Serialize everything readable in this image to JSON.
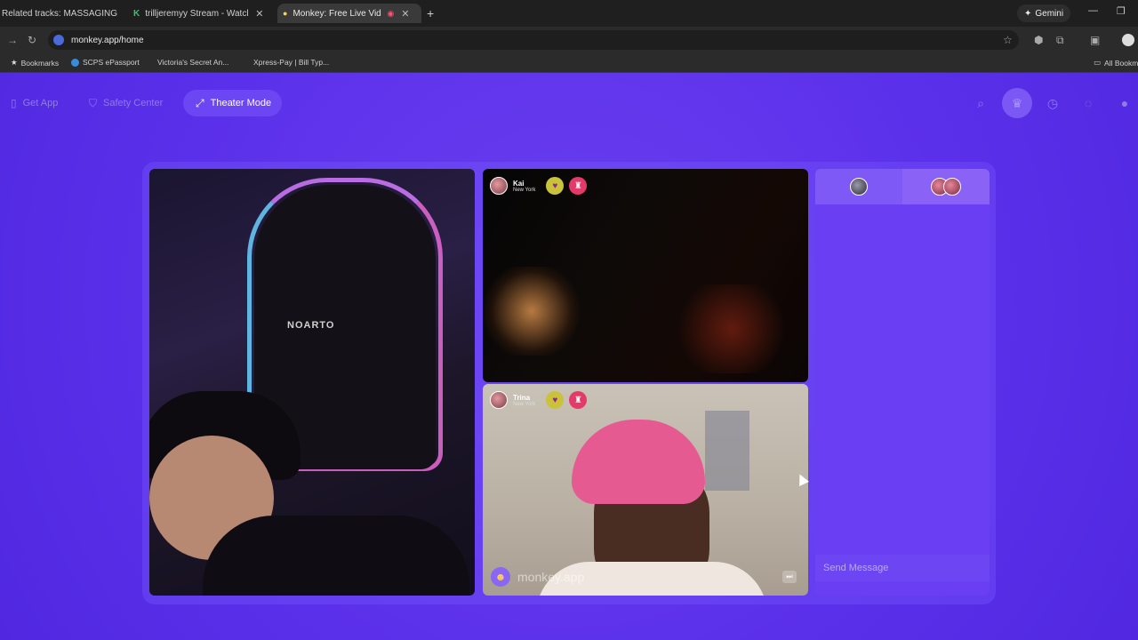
{
  "browser": {
    "tabs": [
      {
        "title": "Related tracks: MASSAGING ME"
      },
      {
        "title": "trilljeremyy Stream - Watch Live"
      },
      {
        "title": "Monkey: Free Live Video Chat"
      }
    ],
    "gemini_label": "Gemini",
    "url": "monkey.app/home",
    "bookmarks": [
      {
        "label": "Bookmarks"
      },
      {
        "label": "SCPS ePassport"
      },
      {
        "label": "Victoria's Secret An..."
      },
      {
        "label": "Xpress-Pay | Bill Typ..."
      }
    ],
    "all_bookmarks_label": "All Bookmarks"
  },
  "topnav": {
    "get_app": "Get App",
    "safety_center": "Safety Center",
    "theater_mode": "Theater Mode"
  },
  "videos": {
    "left": {
      "logo_text": "NOARTO"
    },
    "top": {
      "user_name": "Kai",
      "user_location": "New York"
    },
    "bottom": {
      "user_name": "Trina",
      "user_location": "New York",
      "watermark": "monkey.app"
    }
  },
  "chat": {
    "send_placeholder": "Send Message"
  },
  "icons": {
    "search": "search-icon",
    "crown": "crown-icon",
    "history": "history-icon",
    "messages": "messages-icon",
    "heart": "heart-icon",
    "gift": "gift-icon",
    "skip": "skip-icon"
  },
  "colors": {
    "page_bg": "#5a2fe6",
    "theater_button": "#6b46f2",
    "chat_panel": "#6a3ef3"
  }
}
